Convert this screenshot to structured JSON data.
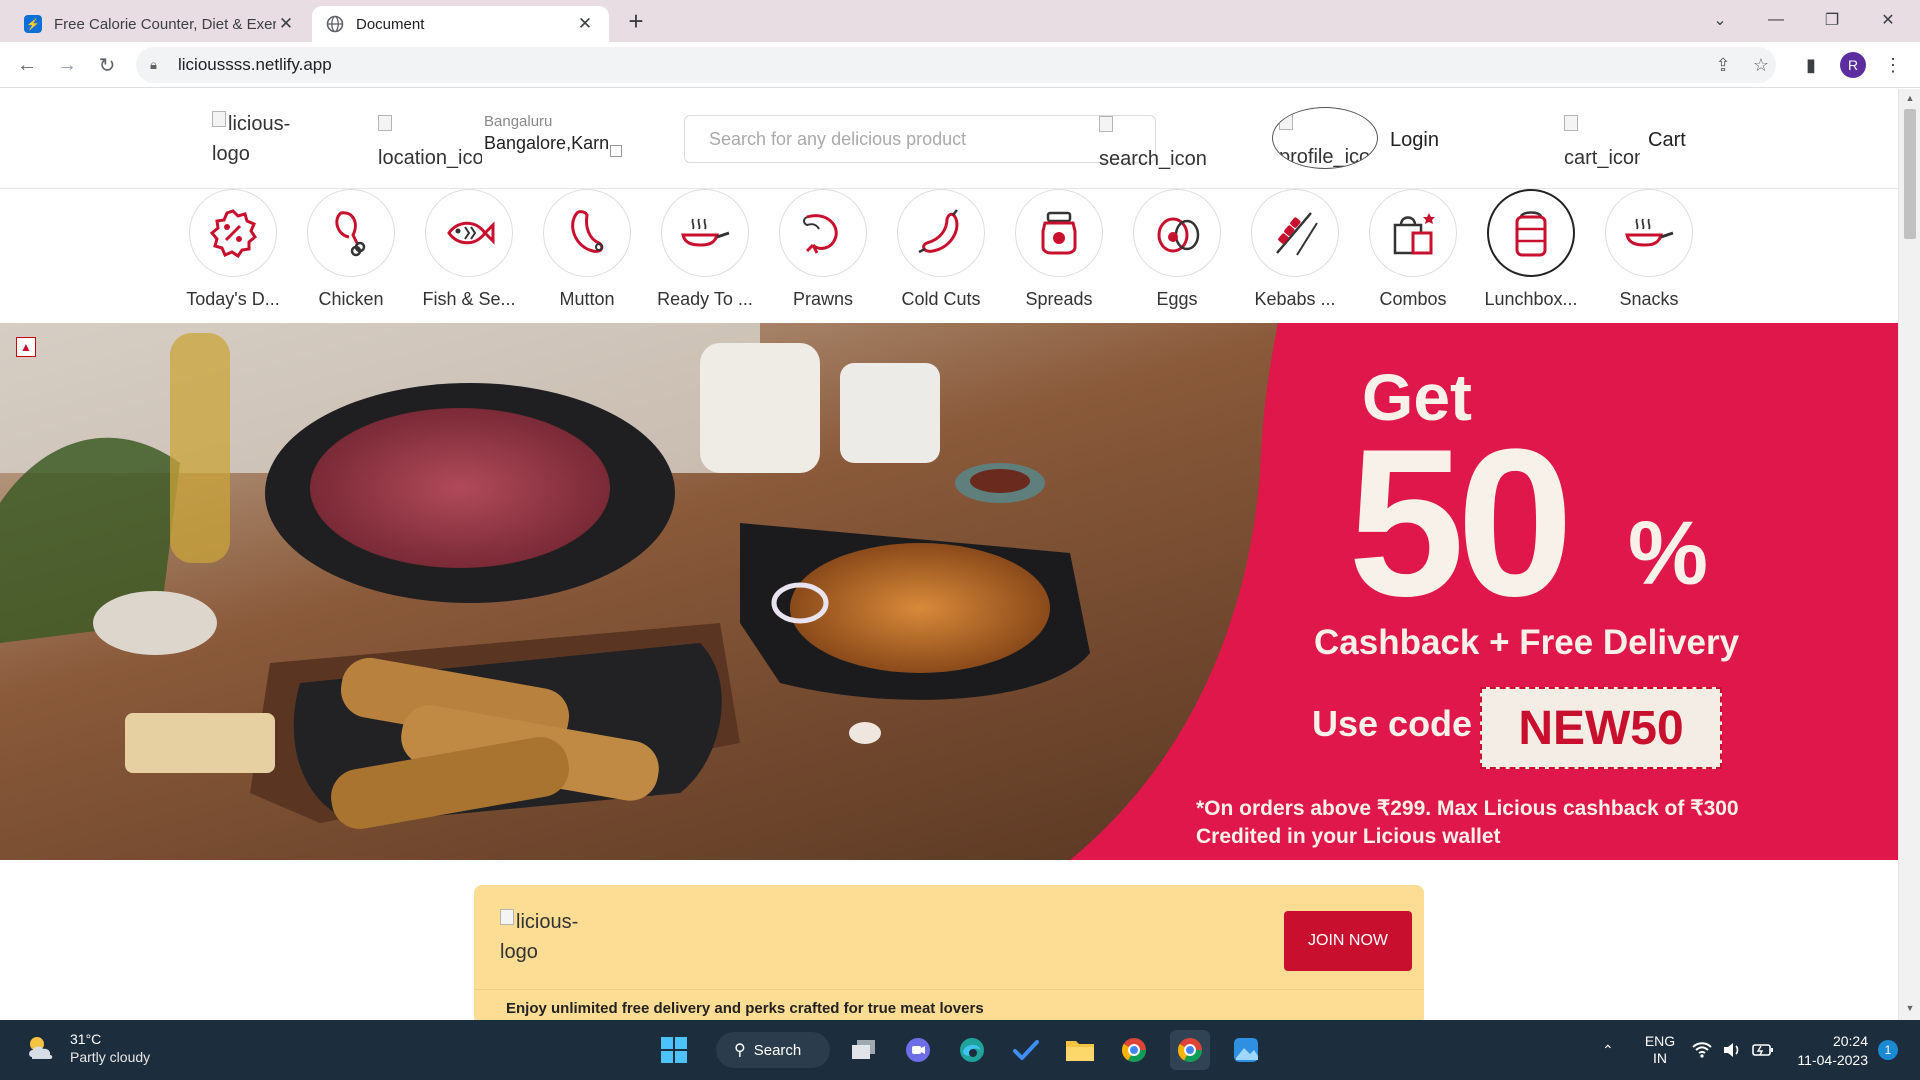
{
  "browser": {
    "tabs": [
      {
        "title": "Free Calorie Counter, Diet & Exer",
        "active": false,
        "favicon": "myfitnesspal-icon"
      },
      {
        "title": "Document",
        "active": true,
        "favicon": "globe-icon"
      }
    ],
    "url": "licioussss.netlify.app",
    "profile_initial": "R"
  },
  "header": {
    "logo_alt": "licious-logo",
    "location_icon_alt": "location_icon",
    "location_city": "Bangaluru",
    "location_address": "Bangalore,Karn",
    "search_placeholder": "Search for any delicious product",
    "search_icon_alt": "search_icon",
    "profile_icon_alt": "profile_icon",
    "login_label": "Login",
    "cart_icon_alt": "cart_icon",
    "cart_label": "Cart"
  },
  "categories": [
    {
      "label": "Today's D...",
      "icon": "discount-icon"
    },
    {
      "label": "Chicken",
      "icon": "chicken-leg-icon"
    },
    {
      "label": "Fish & Se...",
      "icon": "fish-icon"
    },
    {
      "label": "Mutton",
      "icon": "mutton-icon"
    },
    {
      "label": "Ready To ...",
      "icon": "pan-icon"
    },
    {
      "label": "Prawns",
      "icon": "prawn-icon"
    },
    {
      "label": "Cold Cuts",
      "icon": "sausage-icon"
    },
    {
      "label": "Spreads",
      "icon": "jar-icon"
    },
    {
      "label": "Eggs",
      "icon": "egg-icon"
    },
    {
      "label": "Kebabs ...",
      "icon": "kebab-icon"
    },
    {
      "label": "Combos",
      "icon": "combo-bag-icon"
    },
    {
      "label": "Lunchbox...",
      "icon": "lunchbox-icon",
      "selected": true
    },
    {
      "label": "Snacks",
      "icon": "pan-icon"
    }
  ],
  "hero": {
    "get": "Get",
    "big_number": "50",
    "percent": "%",
    "line": "Cashback + Free Delivery",
    "use_code": "Use code",
    "code": "NEW50",
    "note_line1": "*On orders above ₹299. Max Licious cashback of ₹300",
    "note_line2": "Credited in your Licious wallet",
    "accent": "#e0174a"
  },
  "membership": {
    "logo_alt": "licious-logo",
    "join_label": "JOIN NOW",
    "perks": "Enjoy unlimited free delivery and perks crafted for true meat lovers"
  },
  "taskbar": {
    "temperature": "31°C",
    "condition": "Partly cloudy",
    "search_label": "Search",
    "lang": "ENG",
    "region": "IN",
    "time": "20:24",
    "date": "11-04-2023",
    "notifications": "1"
  },
  "colors": {
    "brand_red": "#c8102e",
    "card_yellow": "#fddc94",
    "taskbar": "#1c2e3d"
  }
}
